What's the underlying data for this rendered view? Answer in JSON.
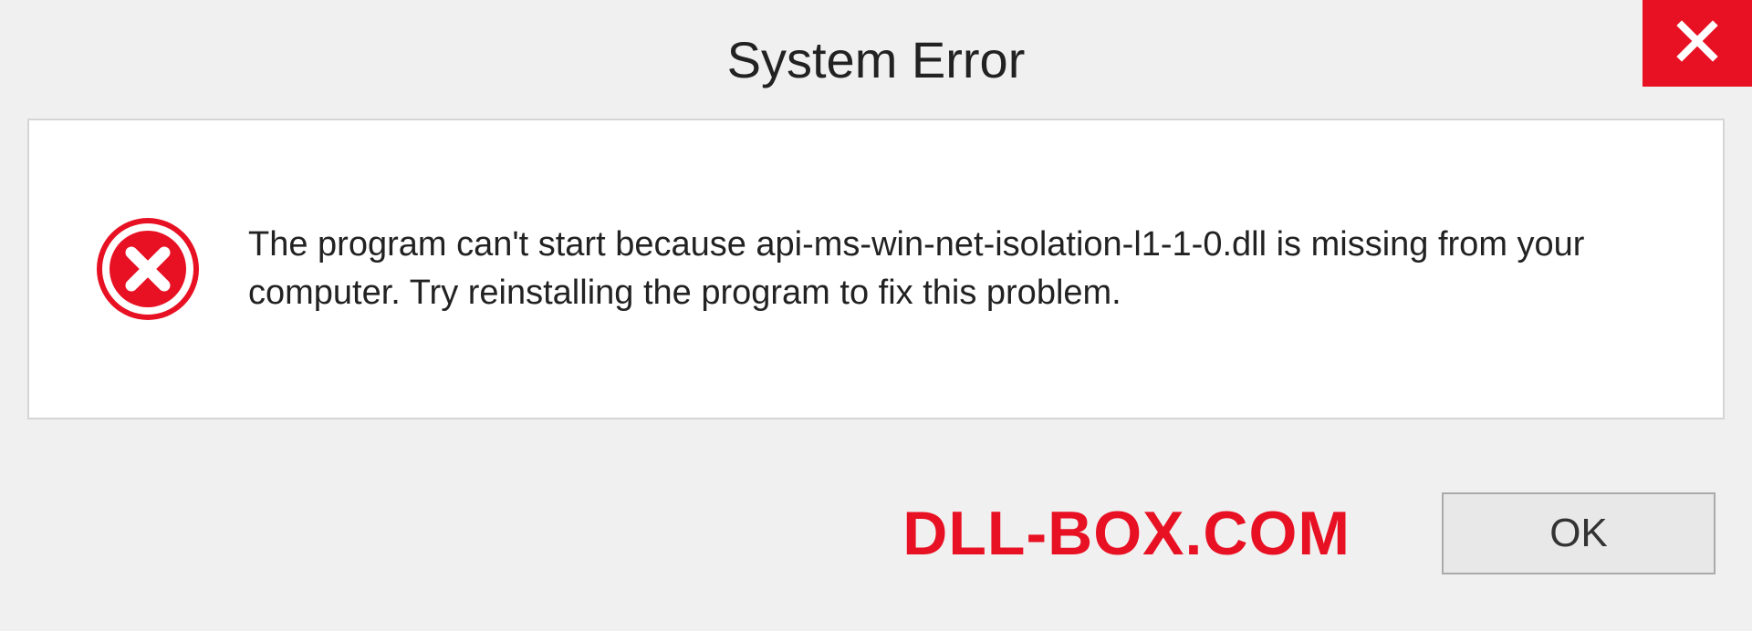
{
  "dialog": {
    "title": "System Error",
    "message": "The program can't start because api-ms-win-net-isolation-l1-1-0.dll is missing from your computer. Try reinstalling the program to fix this problem.",
    "ok_label": "OK"
  },
  "watermark": {
    "text": "DLL-BOX.COM"
  }
}
